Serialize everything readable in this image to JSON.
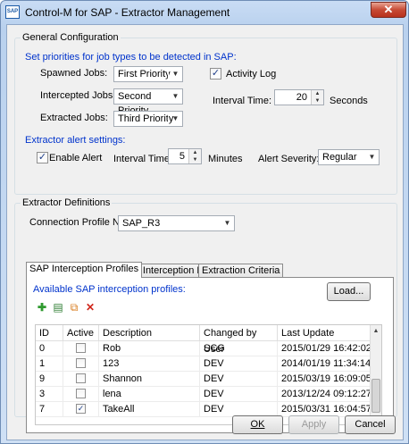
{
  "window": {
    "title": "Control-M for SAP - Extractor Management",
    "icon_text": "SAP",
    "close_symbol": "✕"
  },
  "general": {
    "title": "General Configuration",
    "priorities_heading": "Set priorities for job types to be detected in SAP:",
    "spawned_label": "Spawned Jobs:",
    "spawned_value": "First Priority",
    "intercepted_label": "Intercepted Jobs:",
    "intercepted_value": "Second Priority",
    "extracted_label": "Extracted Jobs:",
    "extracted_value": "Third Priority",
    "activity_log_label": "Activity Log",
    "activity_log_checked": true,
    "interval_label": "Interval Time:",
    "interval_value": "20",
    "interval_unit": "Seconds",
    "alert_heading": "Extractor alert settings:",
    "enable_alert_label": "Enable Alert",
    "enable_alert_checked": true,
    "alert_interval_label": "Interval Time:",
    "alert_interval_value": "5",
    "alert_interval_unit": "Minutes",
    "alert_severity_label": "Alert Severity:",
    "alert_severity_value": "Regular"
  },
  "definitions": {
    "title": "Extractor Definitions",
    "profile_label": "Connection Profile Name:",
    "profile_value": "SAP_R3",
    "tabs": [
      "SAP Interception Profiles",
      "CTM Interception Rules",
      "Extraction Criteria"
    ],
    "available_label": "Available SAP interception profiles:",
    "load_button": "Load...",
    "toolbar_icons": [
      "add-icon",
      "edit-icon",
      "duplicate-icon",
      "delete-icon"
    ],
    "columns": [
      "ID",
      "Active",
      "Description",
      "Changed by User",
      "Last Update"
    ],
    "rows": [
      {
        "id": "0",
        "active": false,
        "description": "Rob",
        "user": "SCG",
        "updated": "2015/01/29 16:42:02"
      },
      {
        "id": "1",
        "active": false,
        "description": "123",
        "user": "DEV",
        "updated": "2014/01/19 11:34:14"
      },
      {
        "id": "9",
        "active": false,
        "description": "Shannon",
        "user": "DEV",
        "updated": "2015/03/19 16:09:05"
      },
      {
        "id": "3",
        "active": false,
        "description": "lena",
        "user": "DEV",
        "updated": "2013/12/24 09:12:27"
      },
      {
        "id": "7",
        "active": true,
        "description": "TakeAll",
        "user": "DEV",
        "updated": "2015/03/31 16:04:57"
      }
    ]
  },
  "footer": {
    "ok": "OK",
    "apply": "Apply",
    "cancel": "Cancel"
  },
  "colors": {
    "heading_blue": "#0033cc",
    "close_red": "#c74a34"
  }
}
